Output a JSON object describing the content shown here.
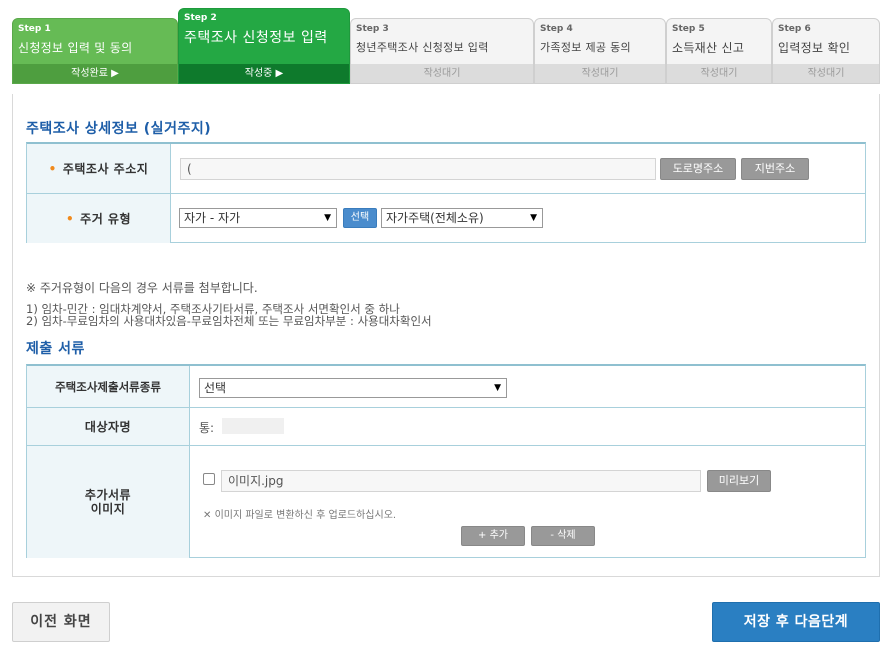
{
  "steps": [
    {
      "num": "Step 1",
      "title": "신청정보 입력 및 동의",
      "status": "작성완료 ▶"
    },
    {
      "num": "Step 2",
      "title": "주택조사 신청정보 입력",
      "status": "작성중 ▶"
    },
    {
      "num": "Step 3",
      "title": "청년주택조사 신청정보 입력",
      "status": "작성대기"
    },
    {
      "num": "Step 4",
      "title": "가족정보 제공 동의",
      "status": "작성대기"
    },
    {
      "num": "Step 5",
      "title": "소득재산 신고",
      "status": "작성대기"
    },
    {
      "num": "Step 6",
      "title": "입력정보 확인",
      "status": "작성대기"
    }
  ],
  "housing": {
    "section_title": "주택조사 상세정보 (실거주지)",
    "address_label": "주택조사 주소지",
    "address_value": "(",
    "road_address_button": "도로명주소",
    "lot_address_button": "지번주소",
    "residence_type_label": "주거 유형",
    "residence_type_value": "자가 - 자가",
    "select_button": "선택",
    "residence_subtype_value": "자가주택(전체소유)"
  },
  "notes": {
    "line1": "※ 주거유형이 다음의 경우 서류를 첨부합니다.",
    "line2": "1) 임차-민간 : 임대차계약서, 주택조사기타서류, 주택조사 서면확인서 중 하나",
    "line3": "2) 임차-무료임차의 사용대차있음-무료임차전체 또는 무료임차부분 : 사용대차확인서"
  },
  "documents": {
    "section_title": "제출 서류",
    "doc_type_label": "주택조사제출서류종류",
    "doc_type_value": "선택",
    "target_name_label": "대상자명",
    "target_name_value": "통:",
    "extra_doc_label_line1": "추가서류",
    "extra_doc_label_line2": "이미지",
    "file_name": "이미지.jpg",
    "preview_button": "미리보기",
    "upload_note": "이미지 파일로 변환하신 후 업로드하십시오.",
    "add_button": "+ 추가",
    "delete_button": "- 삭제"
  },
  "footer": {
    "prev_button": "이전 화면",
    "next_button": "저장 후 다음단계"
  },
  "colors": {
    "active_step": "#24a844",
    "done_step": "#66bb55",
    "section_title": "#1e5ea8",
    "primary_button": "#2a7fc2",
    "required_mark": "#f08a1d"
  }
}
